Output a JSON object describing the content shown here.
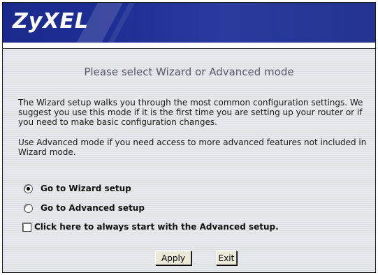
{
  "header": {
    "logo_text": "ZyXEL",
    "banner_color": "#1f2e94"
  },
  "main": {
    "title": "Please select Wizard or Advanced mode",
    "paragraph1": "The Wizard setup walks you through the most common configuration settings. We suggest you use this mode if it is the first time you are setting up your router or if you need to make basic configuration changes.",
    "paragraph2": "Use Advanced mode if you need access to more advanced features not included in Wizard mode."
  },
  "options": {
    "wizard_label": "Go to Wizard setup",
    "wizard_selected": true,
    "advanced_label": "Go to Advanced setup",
    "advanced_selected": false,
    "always_advanced_label": "Click here to always start with the Advanced setup.",
    "always_advanced_checked": false
  },
  "buttons": {
    "apply_label": "Apply",
    "exit_label": "Exit"
  }
}
